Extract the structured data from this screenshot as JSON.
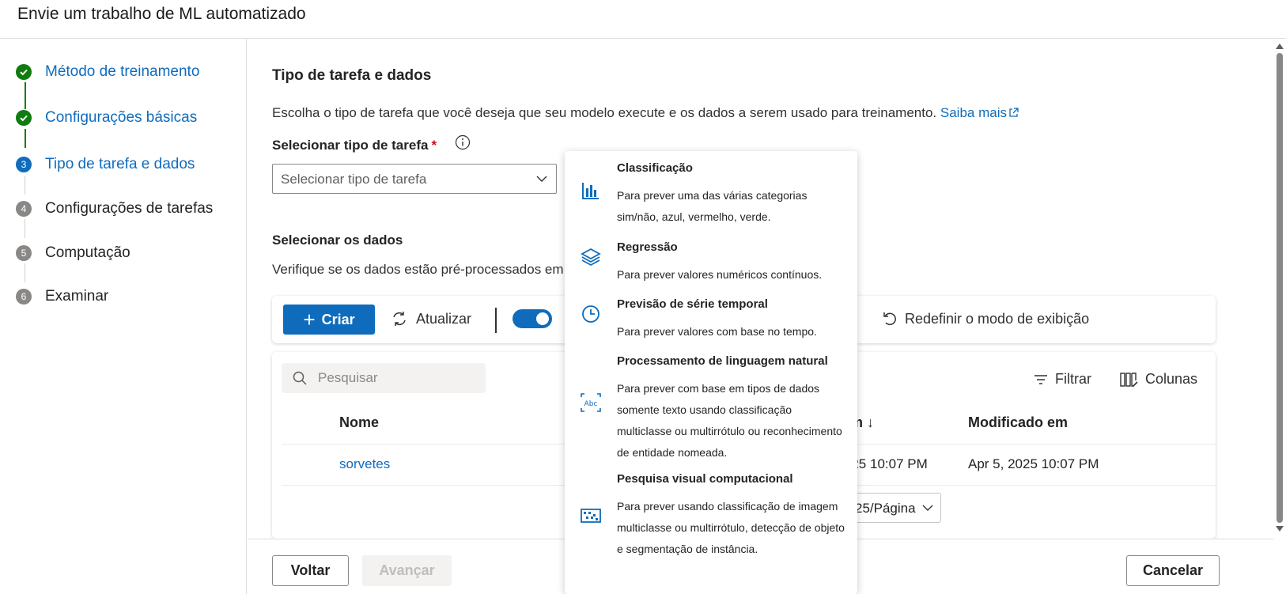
{
  "header": {
    "title": "Envie um trabalho de ML automatizado"
  },
  "steps": [
    {
      "num": "✓",
      "label": "Método de treinamento",
      "state": "done"
    },
    {
      "num": "✓",
      "label": "Configurações básicas",
      "state": "done"
    },
    {
      "num": "3",
      "label": "Tipo de tarefa e dados",
      "state": "active"
    },
    {
      "num": "4",
      "label": "Configurações de tarefas",
      "state": "todo"
    },
    {
      "num": "5",
      "label": "Computação",
      "state": "todo"
    },
    {
      "num": "6",
      "label": "Examinar",
      "state": "todo"
    }
  ],
  "task": {
    "title": "Tipo de tarefa e dados",
    "description": "Escolha o tipo de tarefa que você deseja que seu modelo execute e os dados a serem usado para treinamento.",
    "learn_more": "Saiba mais",
    "select_label": "Selecionar tipo de tarefa",
    "required_mark": "*",
    "select_placeholder": "Selecionar tipo de tarefa"
  },
  "data": {
    "title": "Selecionar os dados",
    "description": "Verifique se os dados estão pré-processados em",
    "create_label": "Criar",
    "refresh_label": "Atualizar",
    "reset_view_label": "Redefinir o modo de exibição",
    "search_placeholder": "Pesquisar",
    "filter_label": "Filtrar",
    "columns_label": "Colunas",
    "headers": {
      "name": "Nome",
      "created": "o em ↓",
      "modified": "Modificado em"
    },
    "rows": [
      {
        "name": "sorvetes",
        "created": ", 2025 10:07 PM",
        "modified": "Apr 5, 2025 10:07 PM"
      }
    ],
    "page_size": "25/Página"
  },
  "dropdown": {
    "options": [
      {
        "title": "Classificação",
        "desc": "Para prever uma das várias categorias sim/não, azul, vermelho, verde.",
        "icon": "bar-chart-icon"
      },
      {
        "title": "Regressão",
        "desc": "Para prever valores numéricos contínuos.",
        "icon": "layers-icon"
      },
      {
        "title": "Previsão de série temporal",
        "desc": "Para prever valores com base no tempo.",
        "icon": "clock-icon"
      },
      {
        "title": "Processamento de linguagem natural",
        "desc": "Para prever com base em tipos de dados somente texto usando classificação multiclasse ou multirrótulo ou reconhecimento de entidade nomeada.",
        "icon": "text-abc-icon"
      },
      {
        "title": "Pesquisa visual computacional",
        "desc": "Para prever usando classificação de imagem multiclasse ou multirrótulo, detecção de objeto e segmentação de instância.",
        "icon": "image-grid-icon"
      }
    ]
  },
  "footer": {
    "back": "Voltar",
    "next": "Avançar",
    "cancel": "Cancelar"
  },
  "colors": {
    "accent": "#0f6cbd",
    "success": "#107c10",
    "required": "#c50f1f"
  }
}
